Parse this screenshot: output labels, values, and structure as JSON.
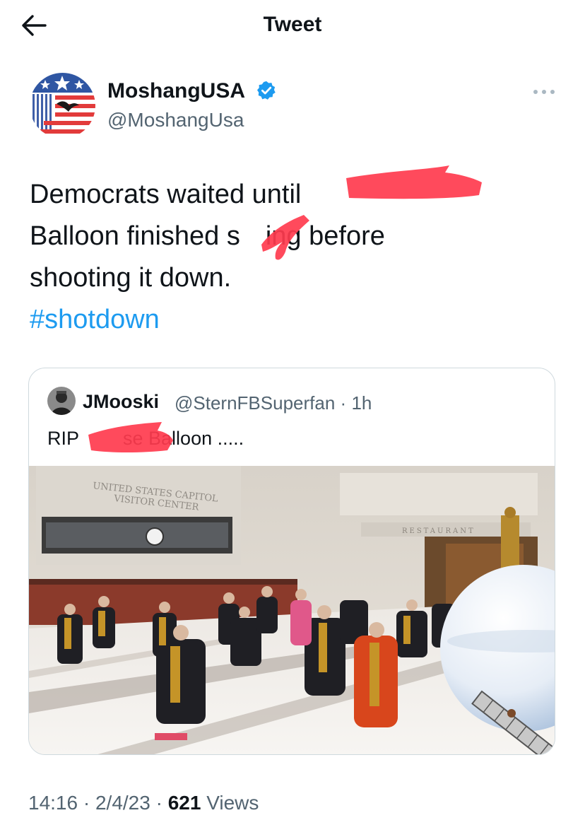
{
  "header": {
    "title": "Tweet",
    "back_icon": "arrow-left-icon"
  },
  "author": {
    "name": "MoshangUSA",
    "handle": "@MoshangUsa",
    "verified_icon": "verified-badge-icon",
    "avatar_icon": "flag-logo-avatar",
    "more_icon": "more-dots-icon"
  },
  "tweet": {
    "line1": "Democrats waited until",
    "line2a": "Balloon finished s",
    "line2b": "ing before",
    "line3": "shooting it down.",
    "hashtag": "#shotdown"
  },
  "quote": {
    "name": "JMooski",
    "handle": "@SternFBSuperfan",
    "dot": "·",
    "time": "1h",
    "text_a": "RIP",
    "text_b": "se Balloon .....",
    "media": {
      "sign_line1": "UNITED STATES CAPITOL",
      "sign_line2": "VISITOR CENTER",
      "restaurant_sign": "RESTAURANT"
    }
  },
  "meta": {
    "time": "14:16",
    "sep1": "·",
    "date": "2/4/23",
    "sep2": "·",
    "views_count": "621",
    "views_label": "Views"
  },
  "colors": {
    "link": "#1d9bf0",
    "verified": "#1d9bf0",
    "secondary": "#536471",
    "redaction": "#ff3b4e"
  }
}
